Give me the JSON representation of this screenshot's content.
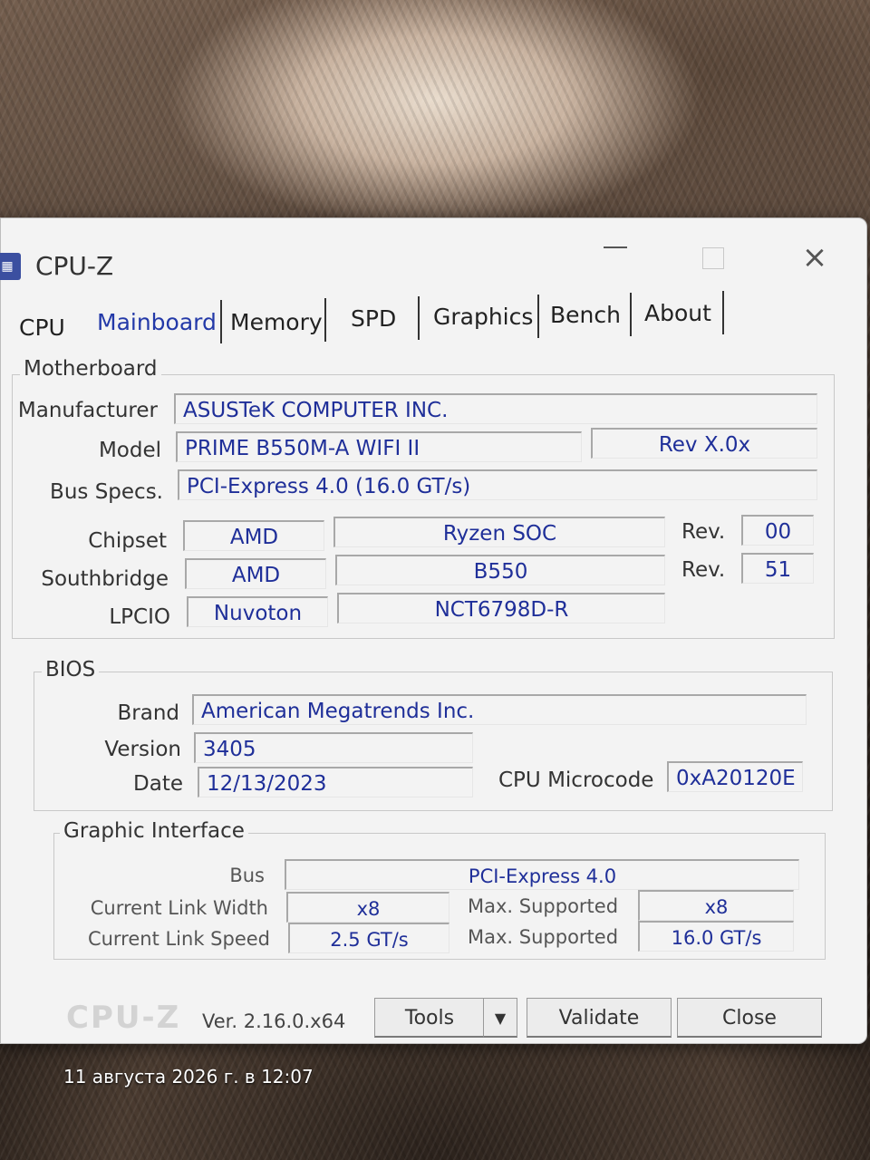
{
  "window": {
    "title": "CPU-Z",
    "minimize_glyph": "",
    "close_glyph": "×",
    "icon": "cpu-z-app-icon"
  },
  "tabs": [
    "CPU",
    "Mainboard",
    "Memory",
    "SPD",
    "Graphics",
    "Bench",
    "About"
  ],
  "active_tab": "Mainboard",
  "motherboard": {
    "group_label": "Motherboard",
    "manufacturer_label": "Manufacturer",
    "manufacturer": "ASUSTeK COMPUTER INC.",
    "model_label": "Model",
    "model": "PRIME B550M-A WIFI II",
    "revision": "Rev X.0x",
    "bus_specs_label": "Bus Specs.",
    "bus_specs": "PCI-Express 4.0 (16.0 GT/s)",
    "chipset_label": "Chipset",
    "chipset_vendor": "AMD",
    "chipset_model": "Ryzen SOC",
    "rev_label": "Rev.",
    "chipset_rev": "00",
    "southbridge_label": "Southbridge",
    "southbridge_vendor": "AMD",
    "southbridge_model": "B550",
    "southbridge_rev": "51",
    "lpcio_label": "LPCIO",
    "lpcio_vendor": "Nuvoton",
    "lpcio_model": "NCT6798D-R"
  },
  "bios": {
    "group_label": "BIOS",
    "brand_label": "Brand",
    "brand": "American Megatrends Inc.",
    "version_label": "Version",
    "version": "3405",
    "date_label": "Date",
    "date": "12/13/2023",
    "microcode_label": "CPU Microcode",
    "microcode": "0xA20120E"
  },
  "graphic_interface": {
    "group_label": "Graphic Interface",
    "bus_label": "Bus",
    "bus": "PCI-Express 4.0",
    "link_width_label": "Current Link Width",
    "link_width": "x8",
    "max_supported_label": "Max. Supported",
    "max_link_width": "x8",
    "link_speed_label": "Current Link Speed",
    "link_speed": "2.5 GT/s",
    "max_link_speed": "16.0 GT/s"
  },
  "footer": {
    "logo": "CPU-Z",
    "version": "Ver. 2.16.0.x64",
    "tools_label": "Tools",
    "tools_arrow": "▼",
    "validate_label": "Validate",
    "close_label": "Close"
  },
  "photo_timestamp": "11 августа 2026 г. в 12:07"
}
